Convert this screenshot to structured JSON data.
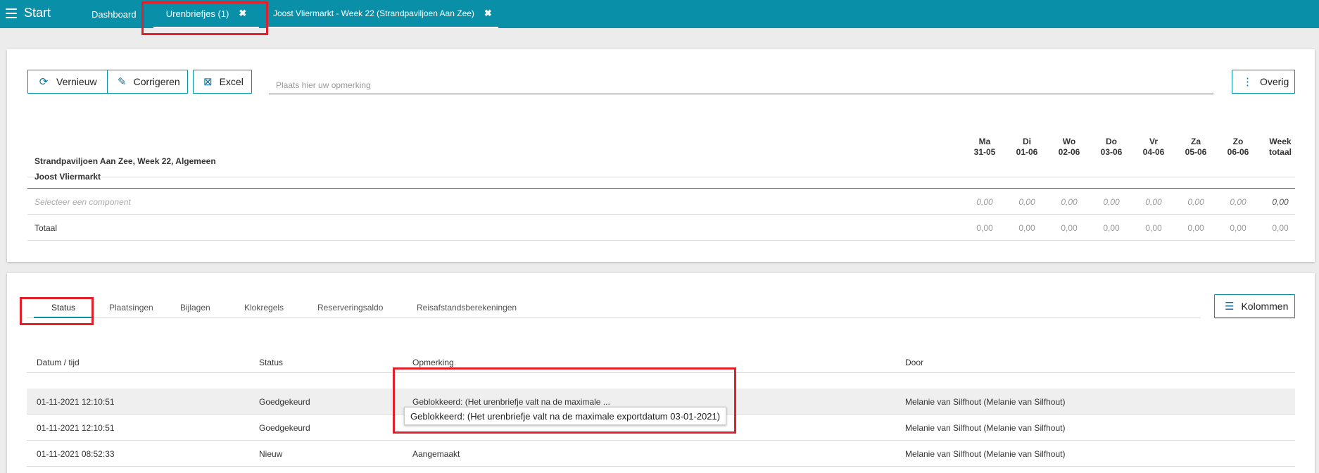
{
  "topbar": {
    "start_label": "Start",
    "tabs": [
      {
        "label": "Dashboard"
      },
      {
        "label": "Urenbriefjes (1)"
      },
      {
        "label": "Joost Vliermarkt - Week 22 (Strandpaviljoen Aan Zee)"
      }
    ],
    "close_glyph": "✖"
  },
  "toolbar": {
    "buttons": [
      {
        "label": "Vernieuw",
        "icon": "refresh-icon"
      },
      {
        "label": "Corrigeren",
        "icon": "pencil-icon"
      },
      {
        "label": "Excel",
        "icon": "excel-icon"
      },
      {
        "label": "Overig",
        "icon": "more-vertical-icon"
      }
    ],
    "remark_placeholder": "Plaats hier uw opmerking"
  },
  "week_table": {
    "title": "Strandpaviljoen Aan Zee, Week 22, Algemeen",
    "days": [
      {
        "d": "Ma",
        "date": "31-05"
      },
      {
        "d": "Di",
        "date": "01-06"
      },
      {
        "d": "Wo",
        "date": "02-06"
      },
      {
        "d": "Do",
        "date": "03-06"
      },
      {
        "d": "Vr",
        "date": "04-06"
      },
      {
        "d": "Za",
        "date": "05-06"
      },
      {
        "d": "Zo",
        "date": "06-06"
      },
      {
        "d": "Week",
        "date": "totaal"
      }
    ],
    "employee": "Joost Vliermarkt",
    "select_label": "Selecteer een component",
    "select_values": [
      "0,00",
      "0,00",
      "0,00",
      "0,00",
      "0,00",
      "0,00",
      "0,00",
      "0,00"
    ],
    "total_label": "Totaal",
    "total_values": [
      "0,00",
      "0,00",
      "0,00",
      "0,00",
      "0,00",
      "0,00",
      "0,00",
      "0,00"
    ]
  },
  "status_tabs": [
    "Status",
    "Plaatsingen",
    "Bijlagen",
    "Klokregels",
    "Reserveringsaldo",
    "Reisafstandsberekeningen"
  ],
  "kolommen_label": "Kolommen",
  "status_table": {
    "headers": [
      "Datum / tijd",
      "Status",
      "Opmerking",
      "Door"
    ],
    "rows": [
      [
        "01-11-2021 12:10:51",
        "Goedgekeurd",
        "Geblokkeerd: (Het urenbriefje valt na de maximale ...",
        "Melanie van Silfhout (Melanie van Silfhout)"
      ],
      [
        "01-11-2021 12:10:51",
        "Goedgekeurd",
        "",
        "Melanie van Silfhout (Melanie van Silfhout)"
      ],
      [
        "01-11-2021 08:52:33",
        "Nieuw",
        "Aangemaakt",
        "Melanie van Silfhout (Melanie van Silfhout)"
      ]
    ]
  },
  "tooltip": "Geblokkeerd: (Het urenbriefje valt na de maximale exportdatum 03-01-2021)",
  "colors": {
    "accent": "#0a8fa8",
    "highlight": "#e0202a"
  }
}
